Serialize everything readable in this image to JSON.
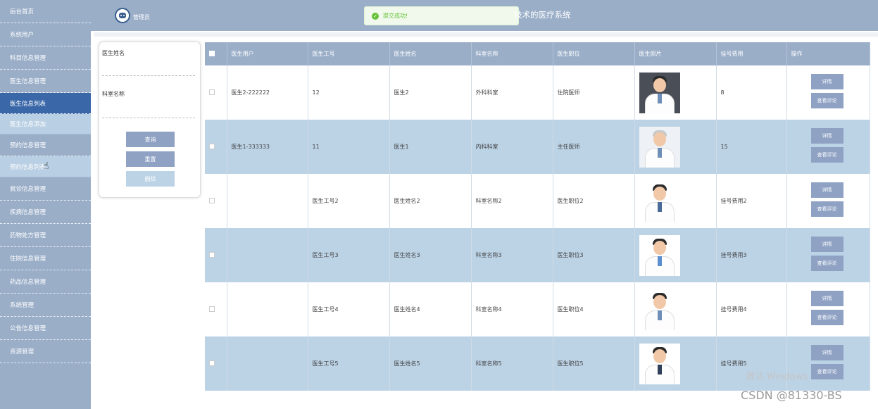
{
  "sidebar": {
    "items": [
      {
        "label": "后台首页"
      },
      {
        "label": "系统用户"
      },
      {
        "label": "科目信息管理"
      },
      {
        "label": "医生信息管理"
      },
      {
        "label": "医生信息列表"
      },
      {
        "label": "医生信息添加"
      },
      {
        "label": "预约信息管理"
      },
      {
        "label": "预约信息列表"
      },
      {
        "label": "就诊信息管理"
      },
      {
        "label": "疾病信息管理"
      },
      {
        "label": "药物处方管理"
      },
      {
        "label": "住院信息管理"
      },
      {
        "label": "药品信息管理"
      },
      {
        "label": "系统管理"
      },
      {
        "label": "公告信息管理"
      },
      {
        "label": "资源管理"
      }
    ]
  },
  "header": {
    "admin_label": "管理员",
    "title": "技术的医疗系统",
    "toast": "提交成功!"
  },
  "search": {
    "name_label": "医生姓名",
    "dept_label": "科室名称",
    "query_btn": "查询",
    "reset_btn": "重置",
    "delete_btn": "删除"
  },
  "table": {
    "headers": [
      "医生用户",
      "医生工号",
      "医生姓名",
      "科室名称",
      "医生职位",
      "医生照片",
      "挂号费用",
      "操作"
    ],
    "detail_btn": "详情",
    "comment_btn": "查看评论",
    "rows": [
      {
        "user": "医生2-222222",
        "no": "12",
        "name": "医生2",
        "dept": "外科科室",
        "title": "住院医师",
        "fee": "8"
      },
      {
        "user": "医生1-333333",
        "no": "11",
        "name": "医生1",
        "dept": "内科科室",
        "title": "主任医师",
        "fee": "15"
      },
      {
        "user": "",
        "no": "医生工号2",
        "name": "医生姓名2",
        "dept": "科室名称2",
        "title": "医生职位2",
        "fee": "挂号费用2"
      },
      {
        "user": "",
        "no": "医生工号3",
        "name": "医生姓名3",
        "dept": "科室名称3",
        "title": "医生职位3",
        "fee": "挂号费用3"
      },
      {
        "user": "",
        "no": "医生工号4",
        "name": "医生姓名4",
        "dept": "科室名称4",
        "title": "医生职位4",
        "fee": "挂号费用4"
      },
      {
        "user": "",
        "no": "医生工号5",
        "name": "医生姓名5",
        "dept": "科室名称5",
        "title": "医生职位5",
        "fee": "挂号费用5"
      }
    ]
  },
  "watermark": {
    "activate": "激活 Windows",
    "csdn": "CSDN @81330-BS"
  }
}
